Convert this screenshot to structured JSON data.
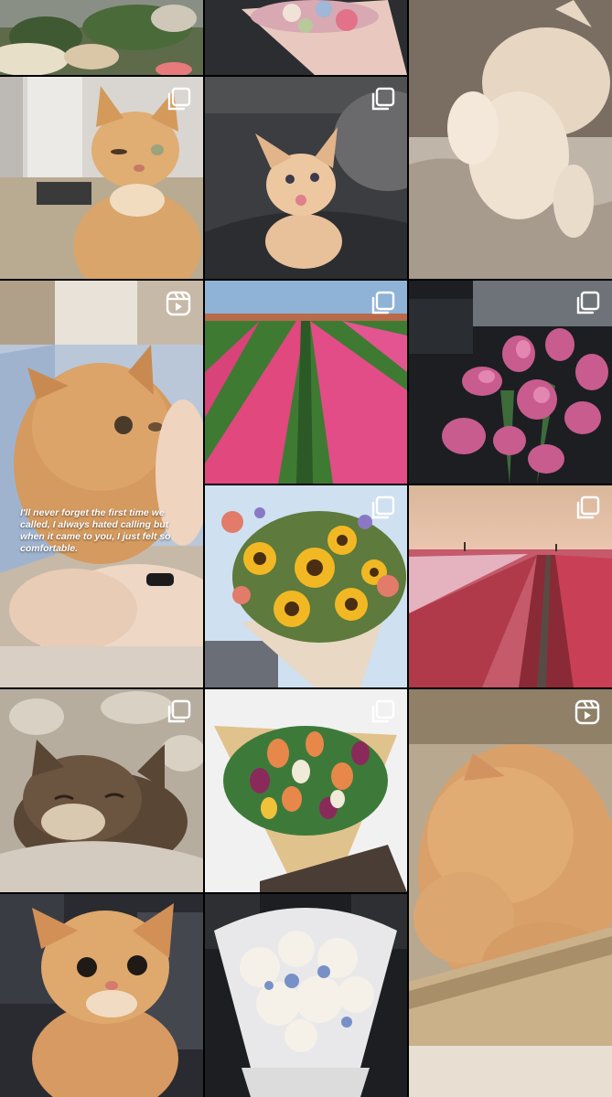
{
  "feed": {
    "posts": [
      {
        "subject": "flower garden"
      },
      {
        "subject": "pastel flower bouquet"
      },
      {
        "subject": "cat on blanket"
      },
      {
        "subject": "ginger cat winking",
        "badge": "carousel-icon"
      },
      {
        "subject": "ginger kitten",
        "badge": "carousel-icon"
      },
      {
        "subject": "ginger kitten in arms",
        "badge": "reel-icon",
        "caption": "I'll never forget the first time we called, I always hated calling but when it came to you, I just felt so comfortable."
      },
      {
        "subject": "pink tulip field",
        "badge": "carousel-icon"
      },
      {
        "subject": "pink tulips in car",
        "badge": "carousel-icon"
      },
      {
        "subject": "sunflower bouquet",
        "badge": "carousel-icon"
      },
      {
        "subject": "tulip fields at sunset",
        "badge": "carousel-icon"
      },
      {
        "subject": "tabby kitten sleeping",
        "badge": "carousel-icon"
      },
      {
        "subject": "tulip bouquet",
        "badge": "carousel-icon"
      },
      {
        "subject": "ginger cat in box",
        "badge": "reel-icon"
      },
      {
        "subject": "ginger cat portrait"
      },
      {
        "subject": "white peony bouquet"
      }
    ]
  },
  "colors": {
    "background": "#000000",
    "badge": "#ffffff"
  }
}
